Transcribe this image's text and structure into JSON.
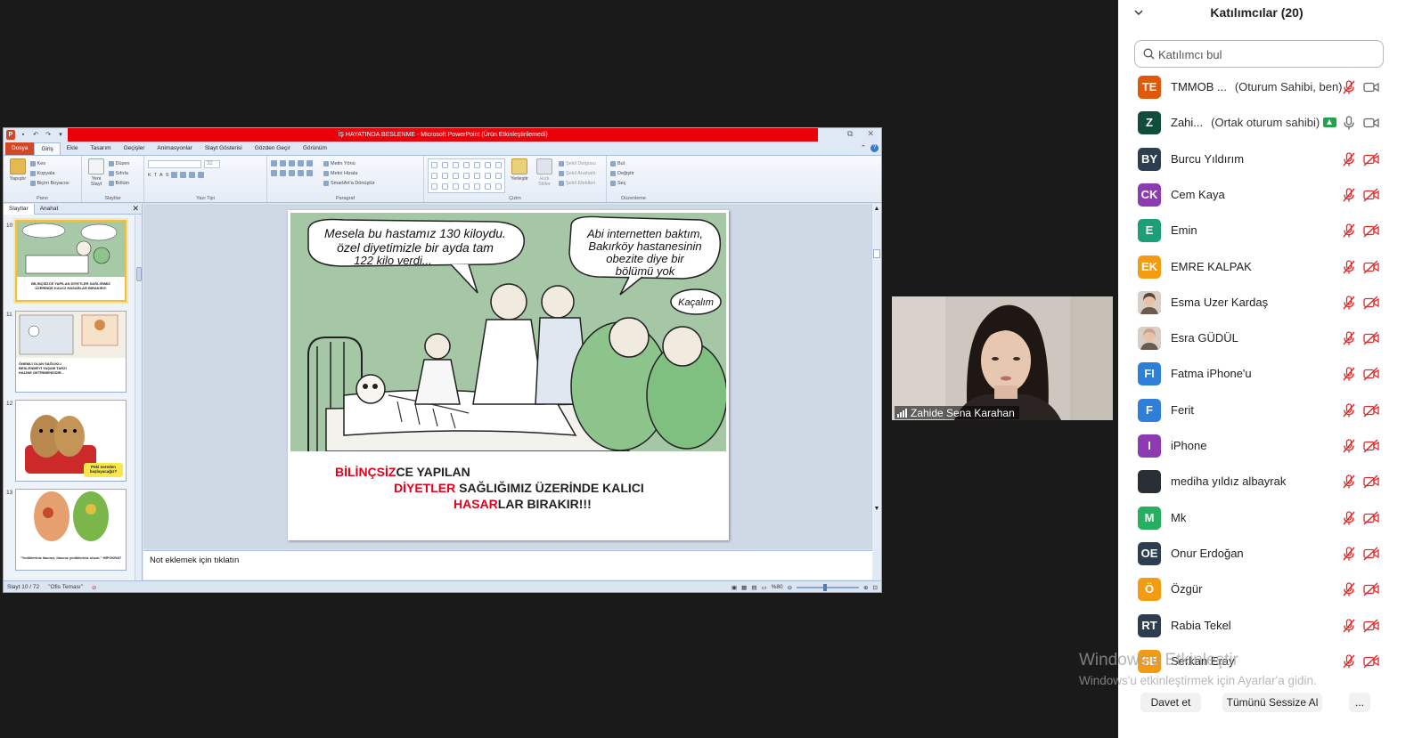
{
  "ppt": {
    "window_title": "İŞ HAYATINDA BESLENME  -  Microsoft PowerPoint (Ürün Etkinleştirilemedi)",
    "tabs": [
      "Dosya",
      "Giriş",
      "Ekle",
      "Tasarım",
      "Geçişler",
      "Animasyonlar",
      "Slayt Gösterisi",
      "Gözden Geçir",
      "Görünüm"
    ],
    "active_tab": "Giriş",
    "ribbon": {
      "pano": {
        "name": "Pano",
        "paste": "Yapıştır",
        "cut": "Kes",
        "copy": "Kopyala",
        "format_painter": "Biçim Boyacısı"
      },
      "slaytlar": {
        "name": "Slaytlar",
        "new_slide": "Yeni Slayt",
        "layout": "Düzen",
        "reset": "Sıfırla",
        "section": "Bölüm"
      },
      "yazi_tipi": {
        "name": "Yazı Tipi",
        "size": "32"
      },
      "paragraf": {
        "name": "Paragraf",
        "text_direction": "Metin Yönü",
        "align_text": "Metni Hizala",
        "smartart": "SmartArt'a Dönüştür"
      },
      "cizim": {
        "name": "Çizim",
        "arrange": "Yerleştir",
        "quick_styles": "Hızlı Stiller",
        "fill": "Şekil Dolgusu",
        "outline": "Şekil Anahattı",
        "effects": "Şekil Efektleri"
      },
      "duzenleme": {
        "name": "Düzenleme",
        "find": "Bul",
        "replace": "Değiştir",
        "select": "Seç"
      }
    },
    "thumb_tabs": [
      "Slaytlar",
      "Anahat"
    ],
    "thumbnails": [
      {
        "num": "10",
        "caption": "BİLİNÇSİZCE YAPILAN DİYETLER SAĞLIĞIMIZ ÜZERİNDE KALICI HASARLAR BIRAKIR!!!"
      },
      {
        "num": "11",
        "caption": "ÖNEMLİ OLAN SAĞLIKLI BESLENMEYİ YAŞAM TARZI HALİNE GETİRMENİZDİR..."
      },
      {
        "num": "12",
        "caption": "Peki nereden başlayacağız?"
      },
      {
        "num": "13",
        "caption": "\"Yediklerinîz ilacınız, ilacınız yediklerinîz olsun.\" HİPOKRAT"
      }
    ],
    "slide": {
      "bubble1": [
        "Mesela bu hastamız 130 kiloydu.",
        "özel diyetimizle bir ayda tam",
        "122 kilo verdi..."
      ],
      "bubble2": [
        "Abi internetten baktım,",
        "Bakırköy hastanesinin",
        "obezite diye bir",
        "bölümü yok"
      ],
      "bubble3": "Kaçalım",
      "line1_red": "BİLİNÇSİZ",
      "line1_rest": "CE YAPILAN",
      "line2_red": "DİYETLER",
      "line2_rest": " SAĞLIĞIMIZ ÜZERİNDE KALICI",
      "line3_red": "HASAR",
      "line3_rest": "LAR BIRAKIR!!!"
    },
    "notes_placeholder": "Not eklemek için tıklatın",
    "status": {
      "slide": "Slayt 10 / 72",
      "theme": "\"Ofis Teması\"",
      "zoom": "%80"
    }
  },
  "video": {
    "name": "Zahide Sena Karahan"
  },
  "panel": {
    "title": "Katılımcılar (20)",
    "search_placeholder": "Katılımcı bul",
    "participants": [
      {
        "initials": "TE",
        "name": "TMMOB ...",
        "tag": "(Oturum Sahibi, ben)",
        "color": "#e0590b",
        "mic": "muted",
        "cam": "on"
      },
      {
        "initials": "Z",
        "name": "Zahi...",
        "tag": "(Ortak oturum sahibi)",
        "color": "#114d3b",
        "mic": "on",
        "cam": "on",
        "sharing": true
      },
      {
        "initials": "BY",
        "name": "Burcu Yıldırım",
        "tag": "",
        "color": "#2d3e50",
        "mic": "muted",
        "cam": "off"
      },
      {
        "initials": "CK",
        "name": "Cem Kaya",
        "tag": "",
        "color": "#8e3ab0",
        "mic": "muted",
        "cam": "off"
      },
      {
        "initials": "E",
        "name": "Emin",
        "tag": "",
        "color": "#1c9e76",
        "mic": "muted",
        "cam": "off"
      },
      {
        "initials": "EK",
        "name": "EMRE KALPAK",
        "tag": "",
        "color": "#f39c12",
        "mic": "muted",
        "cam": "off"
      },
      {
        "initials": "",
        "name": "Esma Uzer Kardaş",
        "tag": "",
        "color": "#5b4636",
        "mic": "muted",
        "cam": "off",
        "photo": true
      },
      {
        "initials": "",
        "name": "Esra GÜDÜL",
        "tag": "",
        "color": "#c9a38c",
        "mic": "muted",
        "cam": "off",
        "photo": true
      },
      {
        "initials": "FI",
        "name": "Fatma iPhone'u",
        "tag": "",
        "color": "#2f7ed8",
        "mic": "muted",
        "cam": "off"
      },
      {
        "initials": "F",
        "name": "Ferit",
        "tag": "",
        "color": "#2f7ed8",
        "mic": "muted",
        "cam": "off"
      },
      {
        "initials": "I",
        "name": "iPhone",
        "tag": "",
        "color": "#8e3ab0",
        "mic": "muted",
        "cam": "off"
      },
      {
        "initials": "",
        "name": "mediha yıldız albayrak",
        "tag": "",
        "color": "#2a2f36",
        "mic": "muted",
        "cam": "off"
      },
      {
        "initials": "M",
        "name": "Mk",
        "tag": "",
        "color": "#27ae60",
        "mic": "muted",
        "cam": "off"
      },
      {
        "initials": "OE",
        "name": "Onur Erdoğan",
        "tag": "",
        "color": "#2d3e50",
        "mic": "muted",
        "cam": "off"
      },
      {
        "initials": "Ö",
        "name": "Özgür",
        "tag": "",
        "color": "#f39c12",
        "mic": "muted",
        "cam": "off"
      },
      {
        "initials": "RT",
        "name": "Rabia Tekel",
        "tag": "",
        "color": "#2d3e50",
        "mic": "muted",
        "cam": "off"
      },
      {
        "initials": "SE",
        "name": "Serkan Eray",
        "tag": "",
        "color": "#f39c12",
        "mic": "muted",
        "cam": "off"
      }
    ],
    "invite_label": "Davet et",
    "mute_all_label": "Tümünü Sessize Al",
    "more_label": "..."
  },
  "watermark": {
    "line1": "Windows'u Etkinleştir",
    "line2": "Windows'u etkinleştirmek için Ayarlar'a gidin."
  },
  "colors": {
    "accent_red": "#e4001b",
    "muted_icon": "#e02828",
    "ppt_file_tab": "#d24726"
  }
}
